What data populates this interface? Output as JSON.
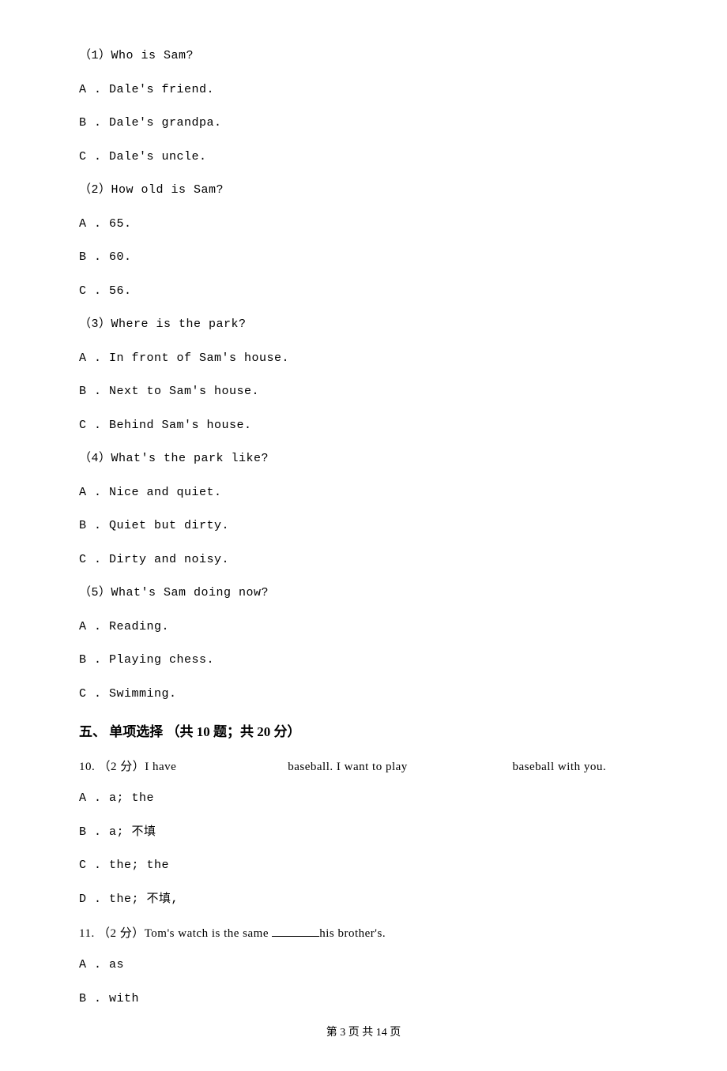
{
  "q1": {
    "prompt": "（1）Who is Sam?",
    "a": "A . Dale's friend.",
    "b": "B . Dale's grandpa.",
    "c": "C . Dale's uncle."
  },
  "q2": {
    "prompt": "（2）How old is Sam?",
    "a": "A . 65.",
    "b": "B . 60.",
    "c": "C . 56."
  },
  "q3": {
    "prompt": "（3）Where is the park?",
    "a": "A . In front of Sam's house.",
    "b": "B . Next to Sam's house.",
    "c": "C . Behind Sam's house."
  },
  "q4": {
    "prompt": "（4）What's the park like?",
    "a": "A . Nice and quiet.",
    "b": "B . Quiet but dirty.",
    "c": "C . Dirty and noisy."
  },
  "q5": {
    "prompt": "（5）What's Sam doing now?",
    "a": "A . Reading.",
    "b": "B . Playing chess.",
    "c": "C . Swimming."
  },
  "section5": {
    "heading": "五、 单项选择 （共 10 题；共 20 分）"
  },
  "q10": {
    "num": "10. （2 分）I have",
    "mid": "baseball. I want to play",
    "end": "baseball with you.",
    "a": "A . a; the",
    "b": "B . a; 不填",
    "c": "C . the; the",
    "d": "D . the; 不填,"
  },
  "q11": {
    "prompt_pre": "11. （2 分）Tom's watch is the same ",
    "prompt_post": "his brother's.",
    "a": "A . as",
    "b": "B . with"
  },
  "footer": "第 3 页 共 14 页"
}
